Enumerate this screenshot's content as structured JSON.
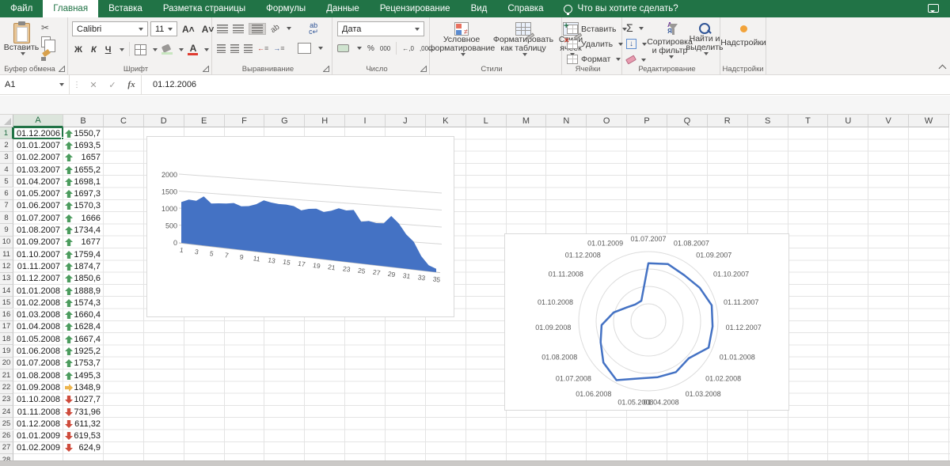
{
  "app": {
    "tabs": [
      {
        "label": "Файл",
        "active": false
      },
      {
        "label": "Главная",
        "active": true
      },
      {
        "label": "Вставка",
        "active": false
      },
      {
        "label": "Разметка страницы",
        "active": false
      },
      {
        "label": "Формулы",
        "active": false
      },
      {
        "label": "Данные",
        "active": false
      },
      {
        "label": "Рецензирование",
        "active": false
      },
      {
        "label": "Вид",
        "active": false
      },
      {
        "label": "Справка",
        "active": false
      }
    ],
    "search_hint": "Что вы хотите сделать?"
  },
  "ribbon": {
    "clipboard": {
      "paste": "Вставить",
      "group": "Буфер обмена"
    },
    "font": {
      "family": "Calibri",
      "size": "11",
      "bold": "Ж",
      "italic": "К",
      "underline": "Ч",
      "group": "Шрифт"
    },
    "alignment": {
      "group": "Выравнивание",
      "wrap": "ab"
    },
    "number": {
      "format": "Дата",
      "percent": "%",
      "thousands": "000",
      "inc_dec": "←,0",
      "dec_dec": ",00→",
      "group": "Число"
    },
    "styles": {
      "conditional": "Условное форматирование",
      "format_table": "Форматировать как таблицу",
      "cell_styles": "Стили ячеек",
      "group": "Стили"
    },
    "cells": {
      "insert": "Вставить",
      "delete": "Удалить",
      "format": "Формат",
      "group": "Ячейки"
    },
    "editing": {
      "autosum": "Σ",
      "sort": "Сортировка и фильтр",
      "find": "Найти и выделить",
      "group": "Редактирование"
    },
    "addins": {
      "label": "Надстройки",
      "group": "Надстройки"
    }
  },
  "formula_bar": {
    "name_box": "A1",
    "value": "01.12.2006",
    "fx": "fx"
  },
  "sheet": {
    "columns": [
      "A",
      "B",
      "C",
      "D",
      "E",
      "F",
      "G",
      "H",
      "I",
      "J",
      "K",
      "L",
      "M",
      "N",
      "O",
      "P",
      "Q",
      "R",
      "S",
      "T",
      "U",
      "V",
      "W"
    ],
    "active_cell": "A1",
    "row_count": 28,
    "rows": [
      {
        "n": 1,
        "date": "01.12.2006",
        "icon": "up",
        "value": "1550,7"
      },
      {
        "n": 2,
        "date": "01.01.2007",
        "icon": "up",
        "value": "1693,5"
      },
      {
        "n": 3,
        "date": "01.02.2007",
        "icon": "up",
        "value": "1657"
      },
      {
        "n": 4,
        "date": "01.03.2007",
        "icon": "up",
        "value": "1655,2"
      },
      {
        "n": 5,
        "date": "01.04.2007",
        "icon": "up",
        "value": "1698,1"
      },
      {
        "n": 6,
        "date": "01.05.2007",
        "icon": "up",
        "value": "1697,3"
      },
      {
        "n": 7,
        "date": "01.06.2007",
        "icon": "up",
        "value": "1570,3"
      },
      {
        "n": 8,
        "date": "01.07.2007",
        "icon": "up",
        "value": "1666"
      },
      {
        "n": 9,
        "date": "01.08.2007",
        "icon": "up",
        "value": "1734,4"
      },
      {
        "n": 10,
        "date": "01.09.2007",
        "icon": "up",
        "value": "1677"
      },
      {
        "n": 11,
        "date": "01.10.2007",
        "icon": "up",
        "value": "1759,4"
      },
      {
        "n": 12,
        "date": "01.11.2007",
        "icon": "up",
        "value": "1874,7"
      },
      {
        "n": 13,
        "date": "01.12.2007",
        "icon": "up",
        "value": "1850,6"
      },
      {
        "n": 14,
        "date": "01.01.2008",
        "icon": "up",
        "value": "1888,9"
      },
      {
        "n": 15,
        "date": "01.02.2008",
        "icon": "up",
        "value": "1574,3"
      },
      {
        "n": 16,
        "date": "01.03.2008",
        "icon": "up",
        "value": "1660,4"
      },
      {
        "n": 17,
        "date": "01.04.2008",
        "icon": "up",
        "value": "1628,4"
      },
      {
        "n": 18,
        "date": "01.05.2008",
        "icon": "up",
        "value": "1667,4"
      },
      {
        "n": 19,
        "date": "01.06.2008",
        "icon": "up",
        "value": "1925,2"
      },
      {
        "n": 20,
        "date": "01.07.2008",
        "icon": "up",
        "value": "1753,7"
      },
      {
        "n": 21,
        "date": "01.08.2008",
        "icon": "up",
        "value": "1495,3"
      },
      {
        "n": 22,
        "date": "01.09.2008",
        "icon": "right",
        "value": "1348,9"
      },
      {
        "n": 23,
        "date": "01.10.2008",
        "icon": "down",
        "value": "1027,7"
      },
      {
        "n": 24,
        "date": "01.11.2008",
        "icon": "down",
        "value": "731,96"
      },
      {
        "n": 25,
        "date": "01.12.2008",
        "icon": "down",
        "value": "611,32"
      },
      {
        "n": 26,
        "date": "01.01.2009",
        "icon": "down",
        "value": "619,53"
      },
      {
        "n": 27,
        "date": "01.02.2009",
        "icon": "down",
        "value": "624,9"
      }
    ],
    "icon_colors": {
      "up": "#4C9C5E",
      "right": "#EDB54E",
      "down": "#CE4B3C"
    }
  },
  "chart_data": [
    {
      "type": "area",
      "style": "3d",
      "title": "",
      "x": [
        1,
        2,
        3,
        4,
        5,
        6,
        7,
        8,
        9,
        10,
        11,
        12,
        13,
        14,
        15,
        16,
        17,
        18,
        19,
        20,
        21,
        22,
        23,
        24,
        25,
        26,
        27,
        28,
        29,
        30,
        31,
        32,
        33,
        34,
        35
      ],
      "values": [
        1200,
        1300,
        1290,
        1440,
        1260,
        1290,
        1310,
        1350,
        1280,
        1310,
        1390,
        1530,
        1490,
        1470,
        1480,
        1460,
        1360,
        1430,
        1460,
        1390,
        1450,
        1550,
        1510,
        1550,
        1230,
        1280,
        1240,
        1260,
        1500,
        1310,
        1010,
        820,
        420,
        180,
        100
      ],
      "xticks": [
        1,
        3,
        5,
        7,
        9,
        11,
        13,
        15,
        17,
        19,
        21,
        23,
        25,
        27,
        29,
        31,
        33,
        35
      ],
      "yticks": [
        0,
        500,
        1000,
        1500,
        2000
      ],
      "ylim": [
        0,
        2000
      ],
      "color": "#4472C4",
      "grid": true,
      "legend": "none"
    },
    {
      "type": "radar",
      "title": "",
      "categories": [
        "01.07.2007",
        "01.08.2007",
        "01.09.2007",
        "01.10.2007",
        "01.11.2007",
        "01.12.2007",
        "01.01.2008",
        "01.02.2008",
        "01.03.2008",
        "01.04.2008",
        "01.05.2008",
        "01.06.2008",
        "01.07.2008",
        "01.08.2008",
        "01.09.2008",
        "01.10.2008",
        "01.11.2008",
        "01.12.2008",
        "01.01.2009"
      ],
      "values": [
        1666,
        1734.4,
        1677,
        1759.4,
        1874.7,
        1850.6,
        1888.9,
        1574.3,
        1660.4,
        1628.4,
        1667.4,
        1925.2,
        1753.7,
        1495.3,
        1348.9,
        1027.7,
        731.96,
        611.32,
        619.53
      ],
      "rings": [
        500,
        1000,
        1500,
        2000
      ],
      "max": 2000,
      "color": "#4472C4",
      "legend": "none"
    }
  ]
}
